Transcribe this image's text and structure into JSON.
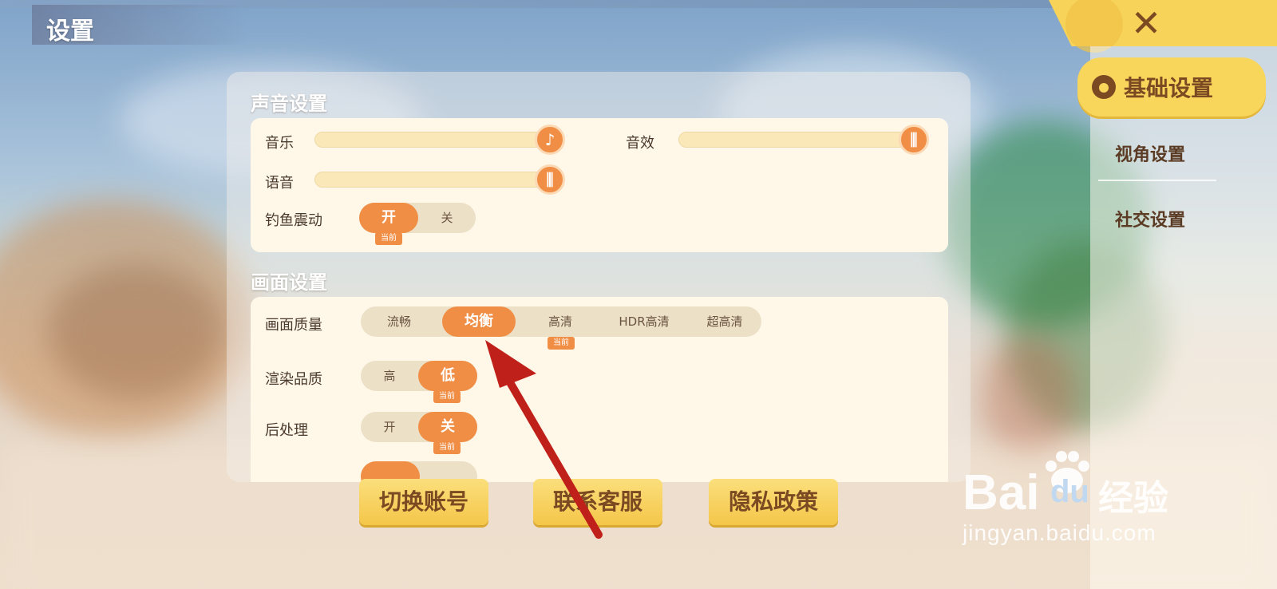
{
  "header": {
    "title": "设置",
    "close_label": "✕"
  },
  "sidebar": {
    "items": [
      {
        "label": "基础设置",
        "active": true
      },
      {
        "label": "视角设置",
        "active": false
      },
      {
        "label": "社交设置",
        "active": false
      }
    ]
  },
  "sound": {
    "title": "声音设置",
    "music": {
      "label": "音乐",
      "level": 0.98,
      "icon": "music-note-icon"
    },
    "sfx": {
      "label": "音效",
      "level": 0.98,
      "icon": "equalizer-icon"
    },
    "voice": {
      "label": "语音",
      "level": 0.98,
      "icon": "equalizer-icon"
    },
    "vibration": {
      "label": "钓鱼震动",
      "options": [
        "开",
        "关"
      ],
      "selected": "开",
      "current_badge": "当前"
    }
  },
  "graphics": {
    "title": "画面设置",
    "quality": {
      "label": "画面质量",
      "options": [
        "流畅",
        "均衡",
        "高清",
        "HDR高清",
        "超高清"
      ],
      "selected": "均衡",
      "current_badge": "当前",
      "current_option": "高清"
    },
    "render": {
      "label": "渲染品质",
      "options": [
        "高",
        "低"
      ],
      "selected": "低",
      "current_badge": "当前"
    },
    "post": {
      "label": "后处理",
      "options": [
        "开",
        "关"
      ],
      "selected": "关",
      "current_badge": "当前"
    }
  },
  "buttons": {
    "switch_account": "切换账号",
    "contact_support": "联系客服",
    "privacy": "隐私政策"
  },
  "watermark": {
    "brand": "Bai",
    "brand2": "du",
    "tag": "经验",
    "url": "jingyan.baidu.com"
  },
  "colors": {
    "accent": "#f08e45",
    "tab_yellow": "#f8d55b",
    "annotation": "#c0201a"
  }
}
